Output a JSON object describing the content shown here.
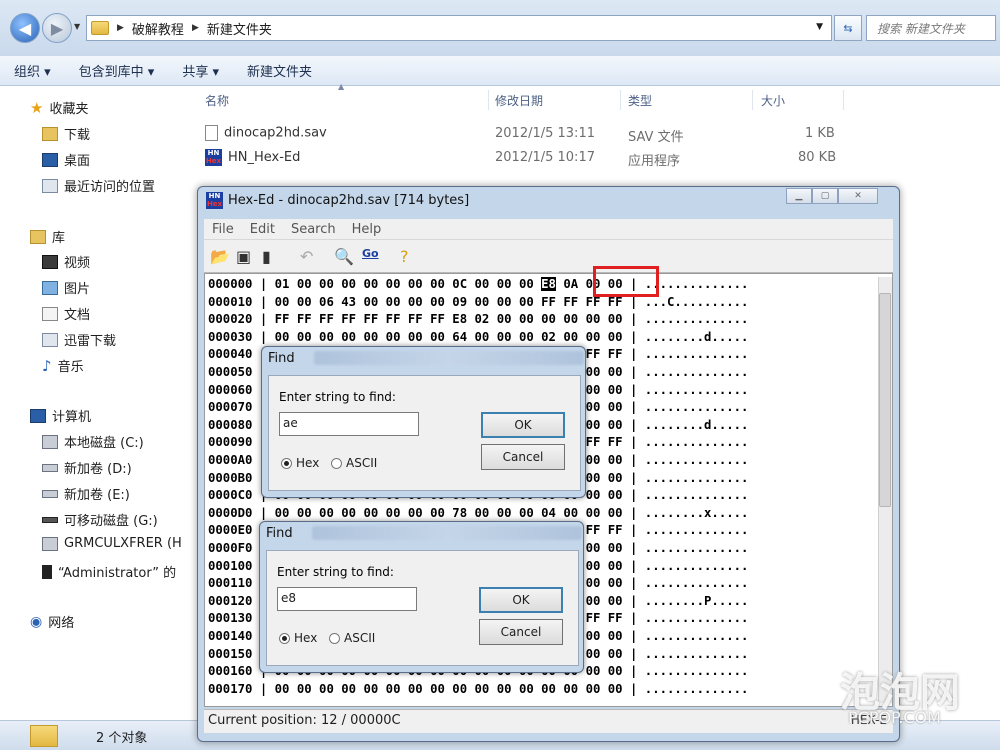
{
  "address": {
    "path": [
      "破解教程",
      "新建文件夹"
    ],
    "search_placeholder": "搜索 新建文件夹"
  },
  "toolbar": {
    "items": [
      "组织 ▾",
      "包含到库中 ▾",
      "共享 ▾",
      "新建文件夹"
    ]
  },
  "nav": {
    "favorites": "收藏夹",
    "fav_items": [
      "下载",
      "桌面",
      "最近访问的位置"
    ],
    "library": "库",
    "lib_items": [
      "视频",
      "图片",
      "文档",
      "迅雷下载",
      "音乐"
    ],
    "computer": "计算机",
    "drives": [
      "本地磁盘 (C:)",
      "新加卷 (D:)",
      "新加卷 (E:)",
      "可移动磁盘 (G:)",
      "GRMCULXFRER (H",
      "“Administrator” 的"
    ],
    "network": "网络"
  },
  "columns": [
    "名称",
    "修改日期",
    "类型",
    "大小"
  ],
  "files": [
    {
      "name": "dinocap2hd.sav",
      "date": "2012/1/5 13:11",
      "type": "SAV 文件",
      "size": "1 KB"
    },
    {
      "name": "HN_Hex-Ed",
      "date": "2012/1/5 10:17",
      "type": "应用程序",
      "size": "80 KB"
    }
  ],
  "status": {
    "count": "2 个对象"
  },
  "hexed": {
    "title": "Hex-Ed - dinocap2hd.sav [714 bytes]",
    "menu": [
      "File",
      "Edit",
      "Search",
      "Help"
    ],
    "tool_go": "Go",
    "lines": [
      "000000 | 01 00 00 00 00 00 00 00 0C 00 00 00 E8 0A 00 00 | ..............",
      "000010 | 00 00 06 43 00 00 00 00 09 00 00 00 FF FF FF FF | ...C..........",
      "000020 | FF FF FF FF FF FF FF FF E8 02 00 00 00 00 00 00 | ..............",
      "000030 | 00 00 00 00 00 00 00 00 64 00 00 00 02 00 00 00 | ........d.....",
      "000040 | 00 00 00 00 00 00 00 00 00 00 00 00 FF FF FF FF | ..............",
      "000050 | 00 00 00 00 00 00 00 00 00 00 00 00 02 00 00 00 | ..............",
      "000060 | 00 00 00 00 00 00 00 00 00 00 00 00 05 00 00 00 | ..............",
      "000070 | 00 00 00 00 00 00 00 00 00 00 00 00 00 00 00 00 | ..............",
      "000080 | 00 00 00 00 00 00 00 00 00 00 00 00 01 00 00 00 | ........d.....",
      "000090 | 00 00 00 00 00 00 00 00 00 00 00 00 FF FF FF FF | ..............",
      "0000A0 | 00 00 00 00 00 00 00 00 00 00 00 00 01 00 00 00 | ..............",
      "0000B0 | 00 00 00 00 00 00 00 00 00 00 00 00 01 00 00 00 | ..............",
      "0000C0 | 00 00 00 00 00 00 00 00 00 00 00 00 00 00 00 00 | ..............",
      "0000D0 | 00 00 00 00 00 00 00 00 78 00 00 00 04 00 00 00 | ........x.....",
      "0000E0 | 00 00 00 00 00 00 00 00 00 00 00 00 FF FF FF FF | ..............",
      "0000F0 | 00 00 00 00 00 00 00 00 00 00 00 00 01 00 00 00 | ..............",
      "000100 | 00 00 00 00 00 00 00 00 00 00 00 00 01 00 00 00 | ..............",
      "000110 | 00 00 00 00 00 00 00 00 00 00 00 00 00 00 00 00 | ..............",
      "000120 | 00 00 00 00 00 00 00 00 00 00 00 00 02 00 00 00 | ........P.....",
      "000130 | 00 00 00 00 00 00 00 00 00 00 00 00 FF FF FF FF | ..............",
      "000140 | 00 00 00 00 00 00 00 00 00 00 00 00 01 00 00 00 | ..............",
      "000150 | 00 00 00 00 00 00 00 00 00 00 00 00 01 00 00 00 | ..............",
      "000160 | 00 00 00 00 00 00 00 00 00 00 00 00 00 00 00 00 | ..............",
      "000170 | 00 00 00 00 00 00 00 00 00 00 00 00 00 00 00 00 | .............."
    ],
    "status": "Current position: 12 / 00000C",
    "mode": "HEX-E"
  },
  "find1": {
    "title": "Find",
    "label": "Enter string to find:",
    "value": "ae",
    "ok": "OK",
    "cancel": "Cancel",
    "hex": "Hex",
    "ascii": "ASCII"
  },
  "find2": {
    "title": "Find",
    "label": "Enter string to find:",
    "value": "e8",
    "ok": "OK",
    "cancel": "Cancel",
    "hex": "Hex",
    "ascii": "ASCII"
  },
  "watermark": {
    "brand": "泡泡网",
    "site": "PCPOP.COM"
  }
}
